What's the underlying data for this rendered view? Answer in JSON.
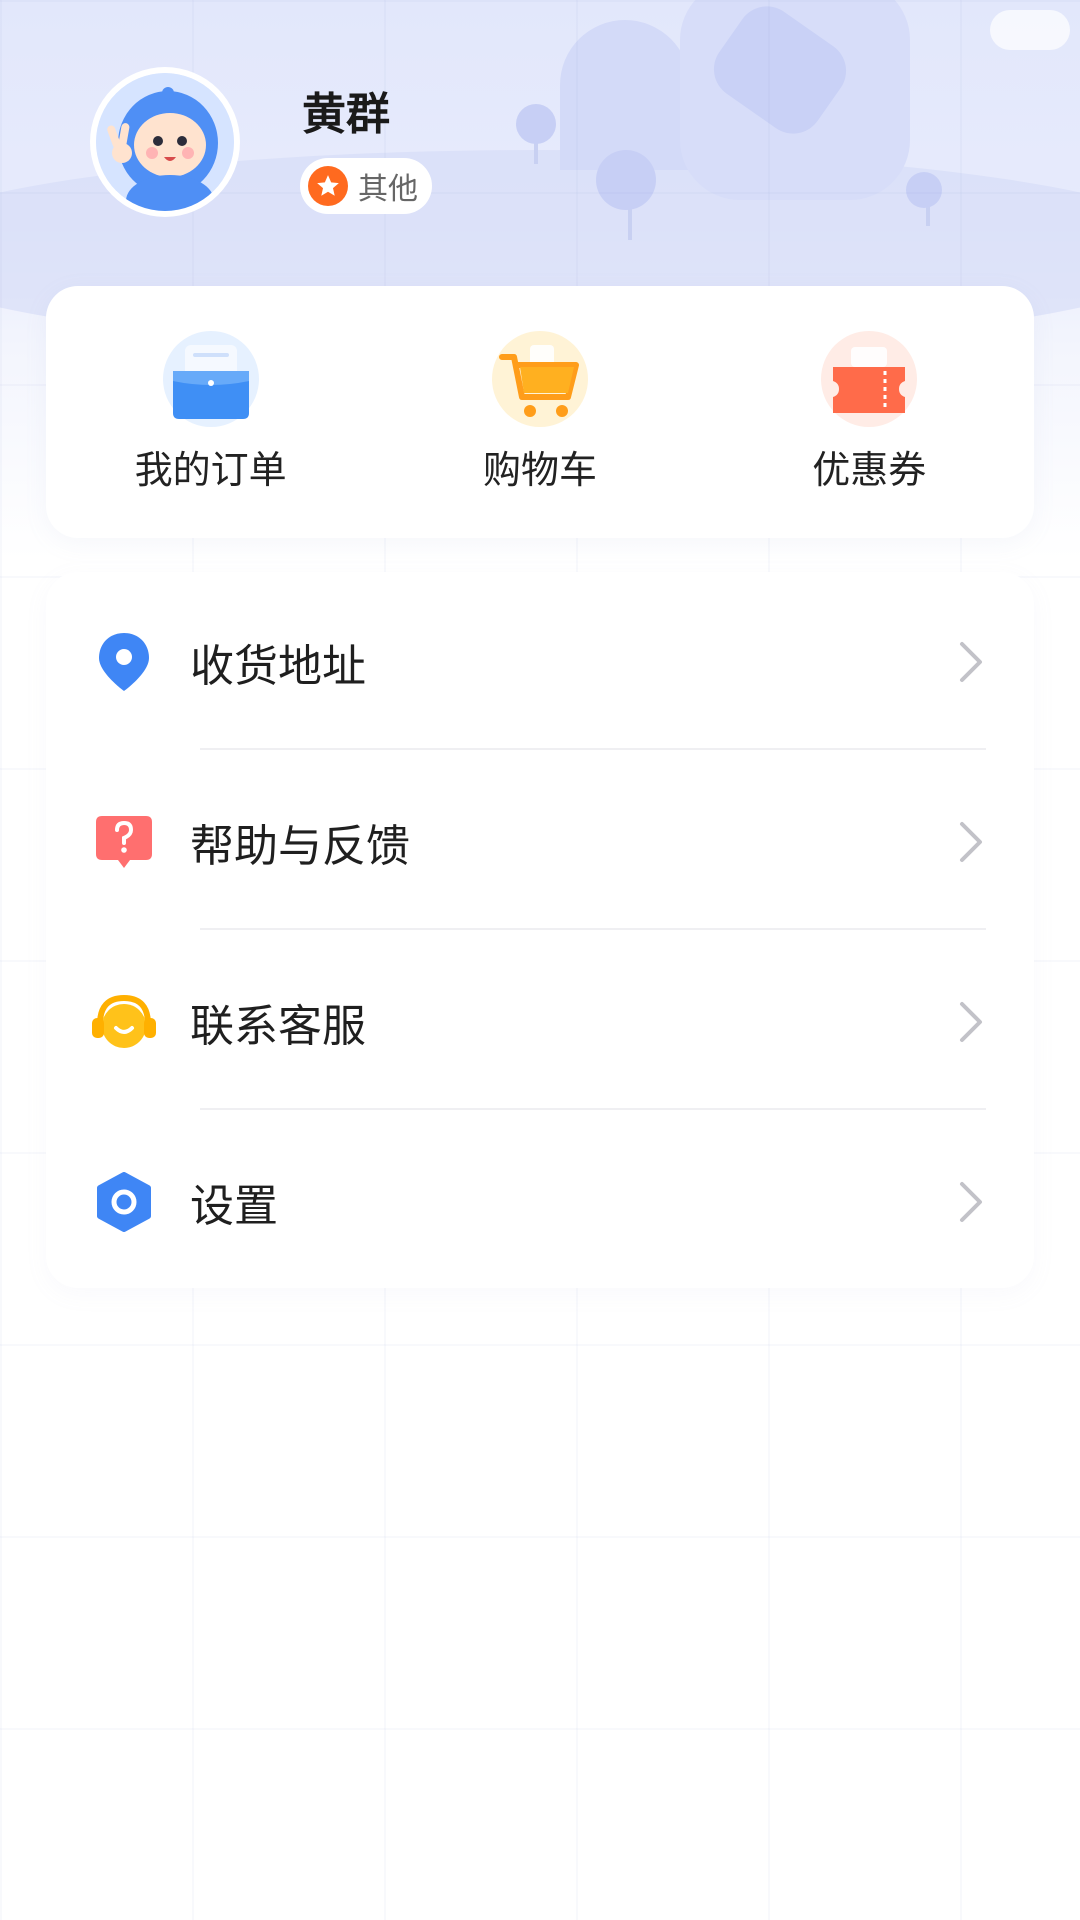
{
  "profile": {
    "name": "黄群",
    "badge_label": "其他",
    "badge_color": "#ff6a1f"
  },
  "quick_actions": [
    {
      "label": "我的订单",
      "icon": "order-folder-icon"
    },
    {
      "label": "购物车",
      "icon": "shopping-cart-icon"
    },
    {
      "label": "优惠券",
      "icon": "coupon-ticket-icon"
    }
  ],
  "menu": [
    {
      "label": "收货地址",
      "icon": "location-pin-icon"
    },
    {
      "label": "帮助与反馈",
      "icon": "help-question-icon"
    },
    {
      "label": "联系客服",
      "icon": "headset-icon"
    },
    {
      "label": "设置",
      "icon": "settings-icon"
    }
  ],
  "colors": {
    "header_gradient_top": "#e2e7fb",
    "accent_blue": "#3f86f5",
    "cart_orange": "#ffb020",
    "coupon_red": "#ff6b4a",
    "help_red": "#ff6f6f",
    "service_yellow": "#ffc21a"
  }
}
